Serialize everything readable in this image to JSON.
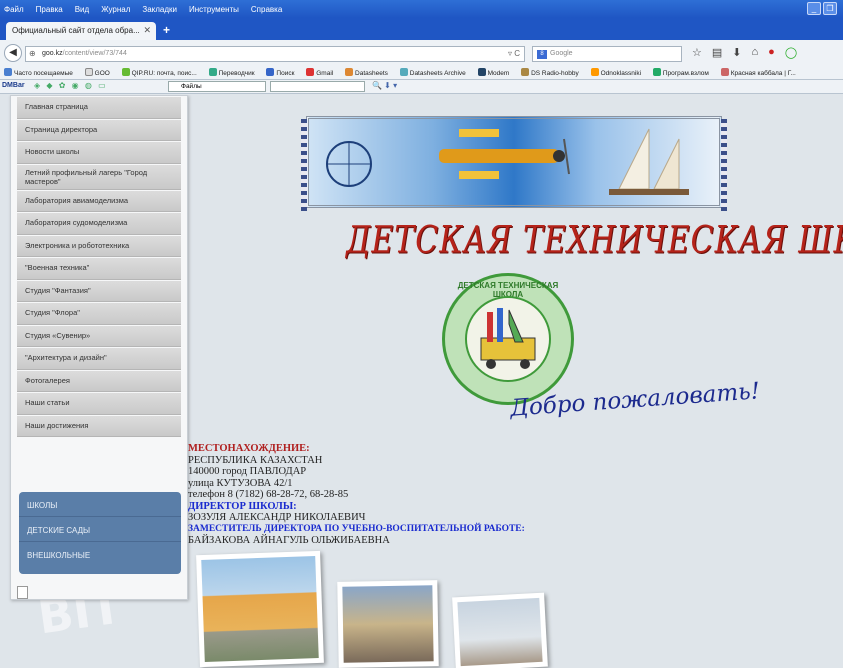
{
  "menubar": {
    "items": [
      "Файл",
      "Правка",
      "Вид",
      "Журнал",
      "Закладки",
      "Инструменты",
      "Справка"
    ]
  },
  "tab": {
    "title": "Официальный сайт отдела обра..."
  },
  "address": {
    "domain": "goo.kz",
    "path": "/content/view/73/744"
  },
  "search": {
    "placeholder": "Google"
  },
  "bookmarks": [
    "Часто посещаемые",
    "GOO",
    "QIP.RU: почта, поис...",
    "Переводчик",
    "Поиск",
    "Gmail",
    "Datasheets",
    "Datasheets Archive",
    "Modem",
    "DS Radio-hobby",
    "Odnoklassniki",
    "Програм.взлом",
    "Красная каббала | Г..."
  ],
  "toolbar2": {
    "brand": "DMBar",
    "select_value": "Файлы"
  },
  "sidebar": {
    "items": [
      "Главная страница",
      "Страница директора",
      "Новости школы",
      "Летний профильный лагерь \"Город мастеров\"",
      "Лаборатория авиамоделизма",
      "Лаборатория судомоделизма",
      "Электроника и робототехника",
      "\"Военная техника\"",
      "Студия \"Фантазия\"",
      "Студия \"Флора\"",
      "Студия «Сувенир»",
      "\"Архитектура и дизайн\"",
      "Фотогалерея",
      "Наши статьи",
      "Наши достижения"
    ],
    "blue_items": [
      "ШКОЛЫ",
      "ДЕТСКИЕ САДЫ",
      "ВНЕШКОЛЬНЫЕ"
    ]
  },
  "main": {
    "title": "ДЕТСКАЯ ТЕХНИЧЕСКАЯ ШКОЛА",
    "emblem_text": "ДЕТСКАЯ ТЕХНИЧЕСКАЯ ШКОЛА",
    "welcome": "Добро пожаловать!",
    "info": {
      "location_label": "МЕСТОНАХОЖДЕНИЕ:",
      "country": "РЕСПУБЛИКА КАЗАХСТАН",
      "city": "140000 город ПАВЛОДАР",
      "street": "улица КУТУЗОВА 42/1",
      "phone": "телефон 8 (7182) 68-28-72, 68-28-85",
      "director_label": "ДИРЕКТОР ШКОЛЫ:",
      "director": "ЗОЗУЛЯ АЛЕКСАНДР НИКОЛАЕВИЧ",
      "deputy_label": "ЗАМЕСТИТЕЛЬ ДИРЕКТОРА ПО УЧЕБНО-ВОСПИТАТЕЛЬНОЙ РАБОТЕ:",
      "deputy": "БАЙЗАКОВА АЙНАГУЛЬ ОЛЬЖИБАЕВНА"
    }
  },
  "colors": {
    "title_red": "#b5231a",
    "welcome_blue": "#1c2a8e",
    "sidebar_blue": "#5a7ea8"
  }
}
